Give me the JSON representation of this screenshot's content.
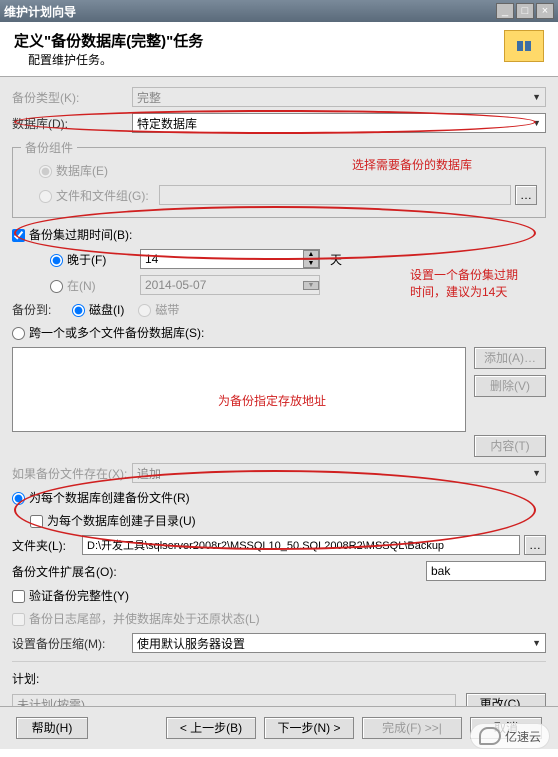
{
  "titlebar": {
    "title": "维护计划向导"
  },
  "header": {
    "title": "定义\"备份数据库(完整)\"任务",
    "subtitle": "配置维护任务。"
  },
  "backup_type": {
    "label": "备份类型(K):",
    "value": "完整"
  },
  "database": {
    "label": "数据库(D):",
    "value": "特定数据库"
  },
  "components": {
    "legend": "备份组件",
    "db": "数据库(E)",
    "files": "文件和文件组(G):"
  },
  "expire": {
    "chk": "备份集过期时间(B):",
    "after_lbl": "晚于(F)",
    "after_val": "14",
    "after_unit": "天",
    "on_lbl": "在(N)",
    "on_val": "2014-05-07"
  },
  "backup_to": {
    "label": "备份到:",
    "disk": "磁盘(I)",
    "tape": "磁带"
  },
  "across": {
    "label": "跨一个或多个文件备份数据库(S):"
  },
  "sidebtn": {
    "add": "添加(A)…",
    "del": "删除(V)",
    "content": "内容(T)"
  },
  "if_exists": {
    "label": "如果备份文件存在(X):",
    "value": "追加"
  },
  "per_db": {
    "lbl": "为每个数据库创建备份文件(R)",
    "sub": "为每个数据库创建子目录(U)"
  },
  "folder": {
    "label": "文件夹(L):",
    "value": "D:\\开发工具\\sqlserver2008r2\\MSSQL10_50.SQL2008R2\\MSSQL\\Backup"
  },
  "ext": {
    "label": "备份文件扩展名(O):",
    "value": "bak"
  },
  "verify": {
    "label": "验证备份完整性(Y)"
  },
  "tail": {
    "label": "备份日志尾部，并使数据库处于还原状态(L)"
  },
  "compress": {
    "label": "设置备份压缩(M):",
    "value": "使用默认服务器设置"
  },
  "sched": {
    "label": "计划:",
    "value": "未计划(按需)",
    "change": "更改(C)…"
  },
  "footer": {
    "help": "帮助(H)",
    "back": "< 上一步(B)",
    "next": "下一步(N) >",
    "finish": "完成(F) >>|",
    "cancel": "取消"
  },
  "annot": {
    "a1": "选择需要备份的数据库",
    "a2": "设置一个备份集过期\n时间，建议为14天",
    "a3": "为备份指定存放地址"
  },
  "watermark": "亿速云"
}
